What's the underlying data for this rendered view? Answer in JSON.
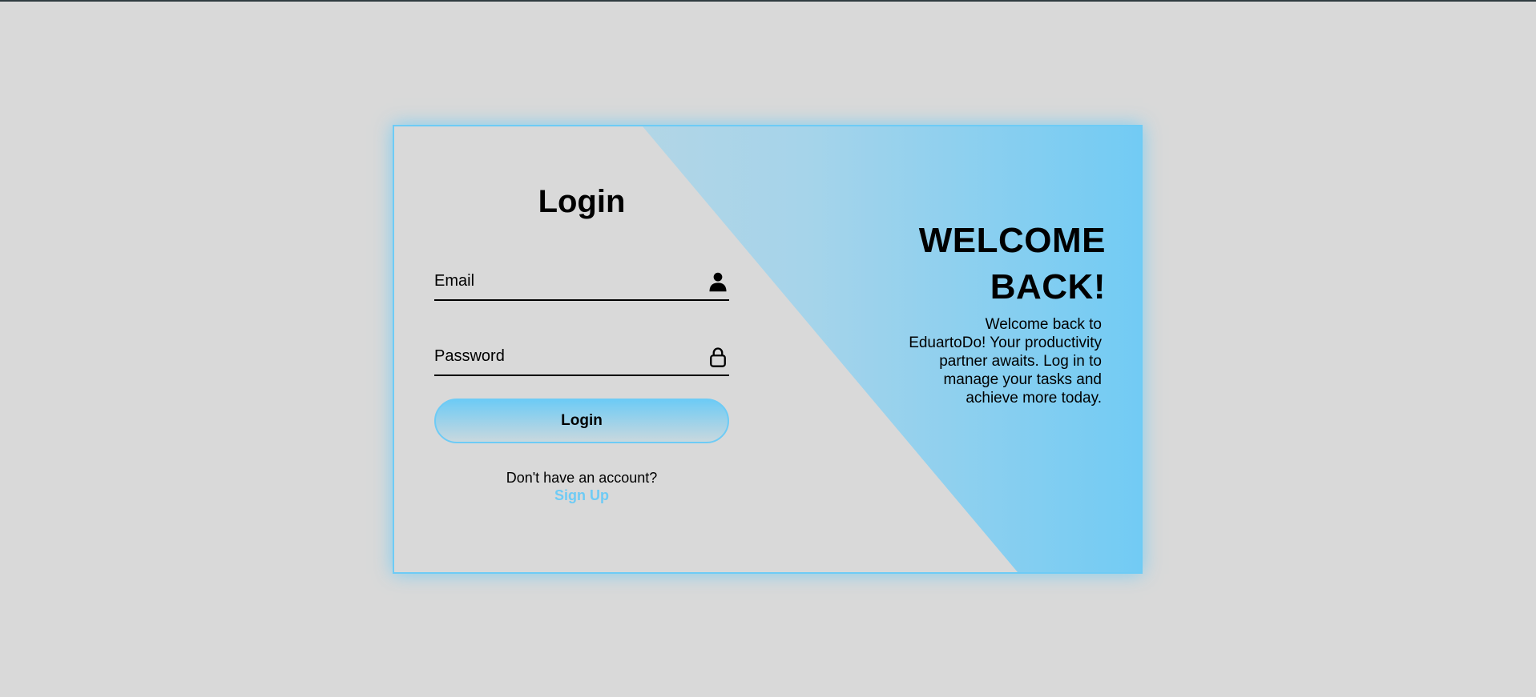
{
  "login": {
    "title": "Login",
    "email_placeholder": "Email",
    "password_placeholder": "Password",
    "button_label": "Login",
    "signup_prompt": "Don't have an account?",
    "signup_link": "Sign Up"
  },
  "welcome": {
    "title": "WELCOME BACK!",
    "message": "Welcome back to EduartoDo! Your productivity partner awaits. Log in to manage your tasks and achieve more today."
  },
  "icons": {
    "email": "user-icon",
    "password": "lock-icon"
  },
  "colors": {
    "background": "#d9d9d9",
    "accent": "#6ecbf5",
    "text": "#000000"
  }
}
